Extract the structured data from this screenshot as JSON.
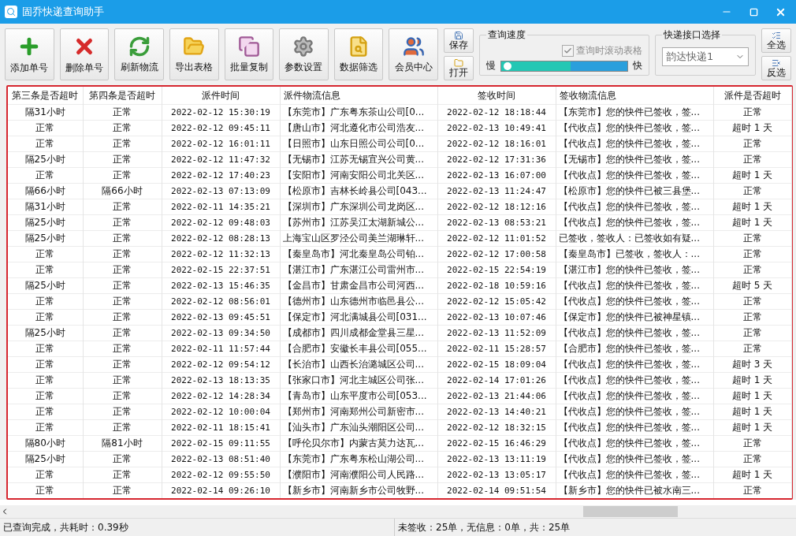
{
  "window": {
    "title": "固乔快递查询助手"
  },
  "toolbar": [
    "添加单号",
    "删除单号",
    "刷新物流",
    "导出表格",
    "批量复制",
    "参数设置",
    "数据筛选",
    "会员中心"
  ],
  "file_buttons": [
    "保存",
    "打开"
  ],
  "speed": {
    "title": "查询速度",
    "slow": "慢",
    "fast": "快",
    "level": 0.03,
    "scroll_option": {
      "label": "查询时滚动表格",
      "checked": true,
      "disabled": true
    }
  },
  "api": {
    "title": "快递接口选择",
    "value": "韵达快递1"
  },
  "select_buttons": [
    "全选",
    "反选"
  ],
  "table": {
    "columns": [
      "第三条是否超时",
      "第四条是否超时",
      "派件时间",
      "派件物流信息",
      "签收时间",
      "签收物流信息",
      "派件是否超时"
    ],
    "rows": [
      [
        "隔31小时",
        "正常",
        "2022-02-12 15:30:19",
        "【东莞市】广东粤东茶山公司[0...",
        "2022-02-12 18:18:44",
        "【东莞市】您的快件已签收，签...",
        "正常"
      ],
      [
        "正常",
        "正常",
        "2022-02-12 09:45:11",
        "【唐山市】河北遵化市公司浩友...",
        "2022-02-13 10:49:41",
        "【代收点】您的快件已签收，签...",
        "超时 1 天"
      ],
      [
        "正常",
        "正常",
        "2022-02-12 16:01:11",
        "【日照市】山东日照公司公司[0...",
        "2022-02-12 18:16:01",
        "【代收点】您的快件已签收，签...",
        "正常"
      ],
      [
        "隔25小时",
        "正常",
        "2022-02-12 11:47:32",
        "【无锡市】江苏无锡宜兴公司黄...",
        "2022-02-12 17:31:36",
        "【无锡市】您的快件已签收，签...",
        "正常"
      ],
      [
        "正常",
        "正常",
        "2022-02-12 17:40:23",
        "【安阳市】河南安阳公司北关区...",
        "2022-02-13 16:07:00",
        "【代收点】您的快件已签收，签...",
        "超时 1 天"
      ],
      [
        "隔66小时",
        "隔66小时",
        "2022-02-13 07:13:09",
        "【松原市】吉林长岭县公司[043...",
        "2022-02-13 11:24:47",
        "【松原市】您的快件已被三县堡...",
        "正常"
      ],
      [
        "隔31小时",
        "正常",
        "2022-02-11 14:35:21",
        "【深圳市】广东深圳公司龙岗区...",
        "2022-02-12 18:12:16",
        "【代收点】您的快件已签收，签...",
        "超时 1 天"
      ],
      [
        "隔25小时",
        "正常",
        "2022-02-12 09:48:03",
        "【苏州市】江苏吴江太湖新城公...",
        "2022-02-13 08:53:21",
        "【代收点】您的快件已签收，签...",
        "超时 1 天"
      ],
      [
        "隔25小时",
        "正常",
        "2022-02-12 08:28:13",
        "上海宝山区罗泾公司美兰湖琳轩...",
        "2022-02-12 11:01:52",
        "已签收，签收人：已签收如有疑...",
        "正常"
      ],
      [
        "正常",
        "正常",
        "2022-02-12 11:32:13",
        "【秦皇岛市】河北秦皇岛公司铂...",
        "2022-02-12 17:00:58",
        "【秦皇岛市】已签收，签收人：...",
        "正常"
      ],
      [
        "正常",
        "正常",
        "2022-02-15 22:37:51",
        "【湛江市】广东湛江公司雷州市...",
        "2022-02-15 22:54:19",
        "【湛江市】您的快件已签收，签...",
        "正常"
      ],
      [
        "隔25小时",
        "正常",
        "2022-02-13 15:46:35",
        "【金昌市】甘肃金昌市公司河西...",
        "2022-02-18 10:59:16",
        "【代收点】您的快件已签收，签...",
        "超时 5 天"
      ],
      [
        "正常",
        "正常",
        "2022-02-12 08:56:01",
        "【德州市】山东德州市临邑县公...",
        "2022-02-12 15:05:42",
        "【代收点】您的快件已签收，签...",
        "正常"
      ],
      [
        "正常",
        "正常",
        "2022-02-13 09:45:51",
        "【保定市】河北满城县公司[031...",
        "2022-02-13 10:07:46",
        "【保定市】您的快件已被神星镇...",
        "正常"
      ],
      [
        "隔25小时",
        "正常",
        "2022-02-13 09:34:50",
        "【成都市】四川成都金堂县三星...",
        "2022-02-13 11:52:09",
        "【代收点】您的快件已签收，签...",
        "正常"
      ],
      [
        "正常",
        "正常",
        "2022-02-11 11:57:44",
        "【合肥市】安徽长丰县公司[055...",
        "2022-02-11 15:28:57",
        "【合肥市】您的快件已签收，签...",
        "正常"
      ],
      [
        "正常",
        "正常",
        "2022-02-12 09:54:12",
        "【长治市】山西长治潞城区公司...",
        "2022-02-15 18:09:04",
        "【代收点】您的快件已签收，签...",
        "超时 3 天"
      ],
      [
        "正常",
        "正常",
        "2022-02-13 18:13:35",
        "【张家口市】河北主城区公司张...",
        "2022-02-14 17:01:26",
        "【代收点】您的快件已签收，签...",
        "超时 1 天"
      ],
      [
        "正常",
        "正常",
        "2022-02-12 14:28:34",
        "【青岛市】山东平度市公司[053...",
        "2022-02-13 21:44:06",
        "【代收点】您的快件已签收，签...",
        "超时 1 天"
      ],
      [
        "正常",
        "正常",
        "2022-02-12 10:00:04",
        "【郑州市】河南郑州公司新密市...",
        "2022-02-13 14:40:21",
        "【代收点】您的快件已签收，签...",
        "超时 1 天"
      ],
      [
        "正常",
        "正常",
        "2022-02-11 18:15:41",
        "【汕头市】广东汕头潮阳区公司...",
        "2022-02-12 18:32:15",
        "【代收点】您的快件已签收，签...",
        "超时 1 天"
      ],
      [
        "隔80小时",
        "隔81小时",
        "2022-02-15 09:11:55",
        "【呼伦贝尔市】内蒙古莫力达瓦...",
        "2022-02-15 16:46:29",
        "【代收点】您的快件已签收，签...",
        "正常"
      ],
      [
        "隔25小时",
        "正常",
        "2022-02-13 08:51:40",
        "【东莞市】广东粤东松山湖公司...",
        "2022-02-13 13:11:19",
        "【代收点】您的快件已签收，签...",
        "正常"
      ],
      [
        "正常",
        "正常",
        "2022-02-12 09:55:50",
        "【濮阳市】河南濮阳公司人民路...",
        "2022-02-13 13:05:17",
        "【代收点】您的快件已签收，签...",
        "超时 1 天"
      ],
      [
        "正常",
        "正常",
        "2022-02-14 09:26:10",
        "【新乡市】河南新乡市公司牧野...",
        "2022-02-14 09:51:54",
        "【新乡市】您的快件已被水南三...",
        "正常"
      ]
    ]
  },
  "status_bar": [
    "已查询完成，共耗时：0.39秒",
    "未签收：25单，无信息：0单，共：25单"
  ]
}
